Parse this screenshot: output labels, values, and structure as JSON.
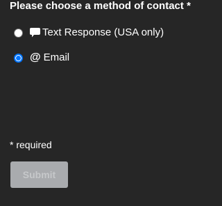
{
  "form": {
    "legend": "Please choose a method of contact *",
    "options": [
      {
        "label": "Text Response (USA only)",
        "icon": "chat-bubble-icon",
        "selected": false
      },
      {
        "label": "Email",
        "icon": "at-sign-icon",
        "icon_glyph": "@",
        "selected": true
      }
    ],
    "required_note": "* required",
    "submit_label": "Submit"
  },
  "colors": {
    "background": "#262626",
    "text": "#ffffff",
    "radio_accent": "#0075ff",
    "submit_bg_disabled": "#a9abae",
    "submit_text_disabled": "#c6c8ca"
  }
}
